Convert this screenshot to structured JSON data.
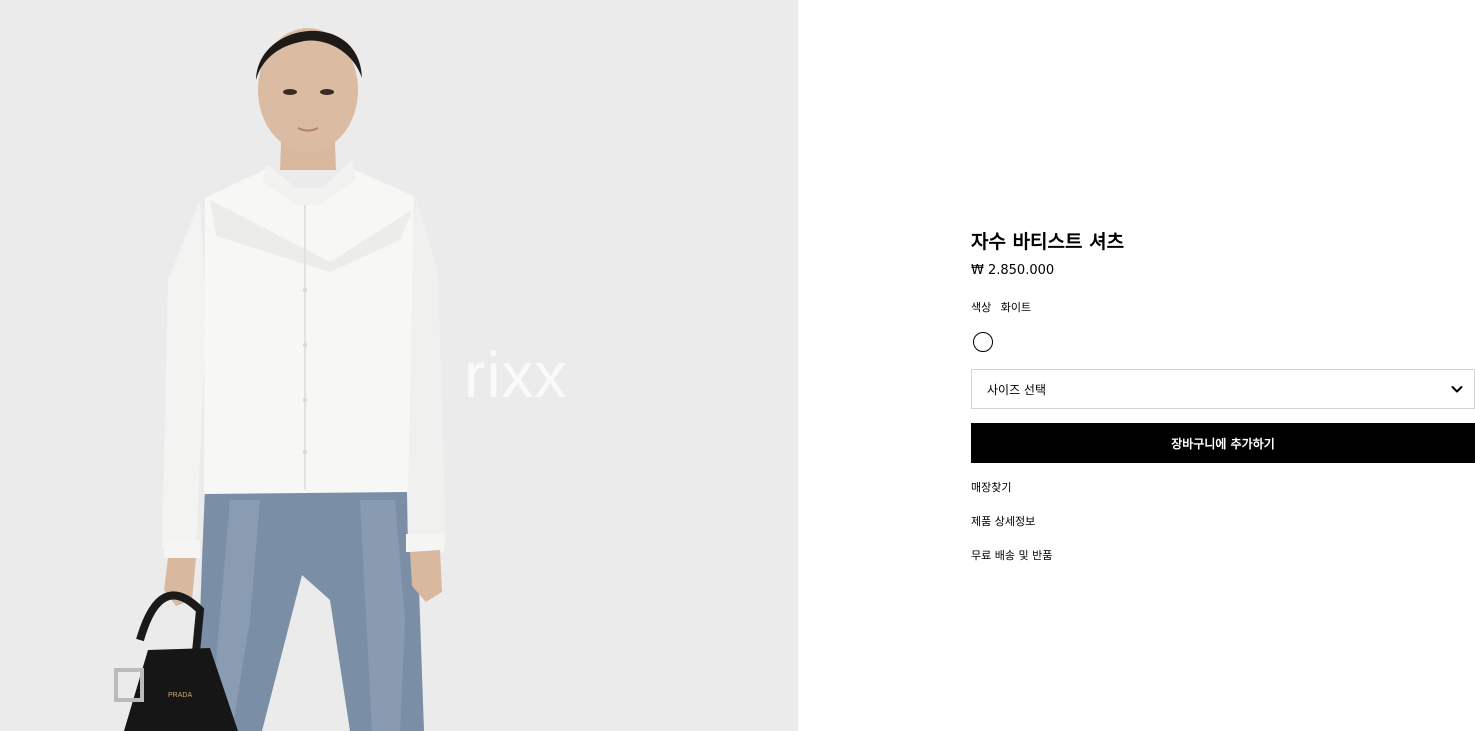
{
  "image": {
    "watermark": "rixx",
    "bag_logo": "PRADA"
  },
  "product": {
    "title": "자수 바티스트 셔츠",
    "price": "₩ 2.850.000",
    "color_label": "색상",
    "color_value": "화이트",
    "swatch_color": "#ffffff"
  },
  "size_select": {
    "label": "사이즈 선택",
    "icon": "chevron-down-icon"
  },
  "actions": {
    "add_to_cart": "장바구니에 추가하기"
  },
  "links": [
    {
      "label": "매장찾기"
    },
    {
      "label": "제품 상세정보"
    },
    {
      "label": "무료 배송 및 반품"
    }
  ],
  "colors": {
    "image_background": "#ebebec",
    "button_background": "#000000",
    "button_text": "#ffffff",
    "select_border": "#d4d4d4"
  }
}
